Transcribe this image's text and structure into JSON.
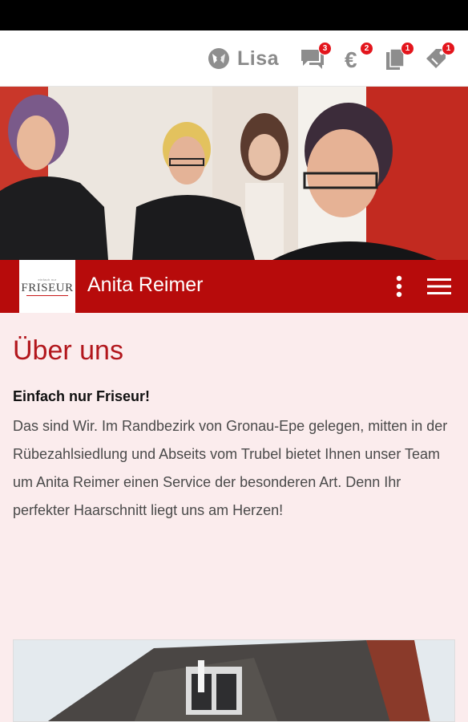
{
  "topbar": {
    "user_name": "Lisa",
    "badges": {
      "messages": "3",
      "payments": "2",
      "documents": "1",
      "coupons": "1"
    },
    "icons": [
      "profile-icon",
      "chat-icon",
      "euro-icon",
      "document-icon",
      "coupon-icon"
    ]
  },
  "header": {
    "title": "Anita Reimer",
    "logo_main": "FRISEUR",
    "logo_small": "einfach nur",
    "icons": [
      "more-vertical-icon",
      "menu-icon"
    ]
  },
  "about": {
    "title": "Über uns",
    "lead": "Einfach nur Friseur!",
    "text": "Das sind Wir. Im Randbezirk von Gronau-Epe gelegen, mitten in der Rübezahlsiedlung und Abseits vom Trubel bietet Ihnen unser Team um Anita Reimer einen Service der besonderen Art. Denn Ihr perfekter Haarschnitt liegt uns am Herzen!"
  },
  "colors": {
    "accent": "#b70b0b",
    "badge": "#e3151c",
    "background": "#fbeced",
    "title_text": "#b2161c"
  }
}
